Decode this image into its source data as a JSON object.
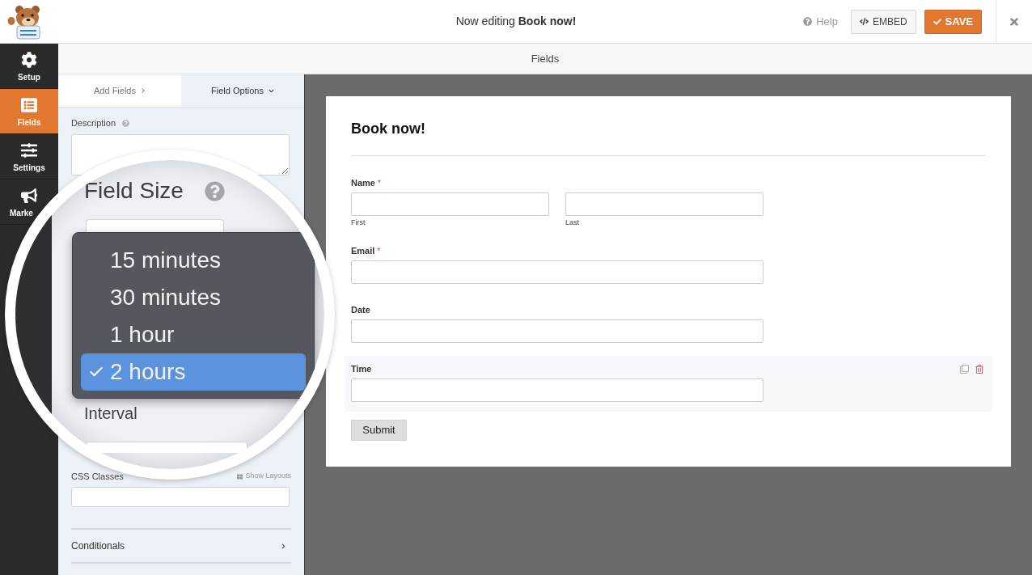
{
  "header": {
    "title": "Now editing **Book now!**",
    "help_link": "Help",
    "embed_button": "EMBED",
    "save_button": "SAVE"
  },
  "sidebar": {
    "items": [
      {
        "label": "Setup",
        "selected": false
      },
      {
        "label": "Fields",
        "selected": true
      },
      {
        "label": "Settings",
        "selected": false
      },
      {
        "label": "Marke",
        "selected": false,
        "cut_off": true
      }
    ]
  },
  "panel_title": "Fields",
  "field_options_panel": {
    "tabs": [
      {
        "label": "Add Fields",
        "selected": false
      },
      {
        "label": "Field Options",
        "selected": true
      }
    ],
    "description_label": "Description",
    "css_classes_label": "CSS Classes",
    "show_layouts_link": "Show Layouts",
    "conditionals_section": "Conditionals"
  },
  "magnifier": {
    "field_size_label": "Field Size",
    "options": [
      {
        "label": "15 minutes",
        "selected": false
      },
      {
        "label": "30 minutes",
        "selected": false
      },
      {
        "label": "1 hour",
        "selected": false
      },
      {
        "label": "2 hours",
        "selected": true
      }
    ],
    "interval_label": "Interval"
  },
  "form_preview": {
    "title": "Book now!",
    "fields": [
      {
        "label": "Name",
        "required_mark": "*",
        "selected": false,
        "inputs": [
          {
            "sublabel": "First"
          },
          {
            "sublabel": "Last"
          }
        ]
      },
      {
        "label": "Email",
        "required_mark": "*",
        "selected": false
      },
      {
        "label": "Date",
        "selected": false
      },
      {
        "label": "Time",
        "selected": true
      }
    ],
    "submit_button": "Submit"
  }
}
